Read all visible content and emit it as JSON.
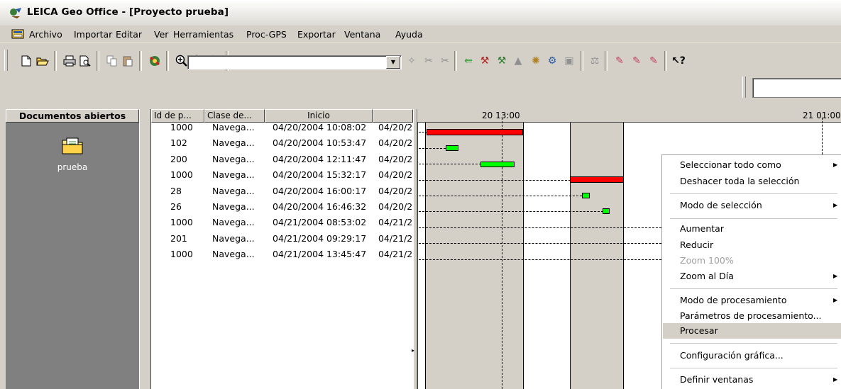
{
  "window": {
    "title": "LEICA Geo Office - [Proyecto prueba]"
  },
  "menu": [
    "Archivo",
    "Importar",
    "Editar",
    "Ver",
    "Herramientas",
    "Proc-GPS",
    "Exportar",
    "Ventana",
    "Ayuda"
  ],
  "toolbar": {
    "icons": [
      "new-document-icon",
      "open-folder-icon",
      "print-icon",
      "print-preview-icon",
      "copy-icon",
      "paste-icon",
      "import-icon",
      "zoom-in-icon",
      "zoom-out-icon",
      "zoom-reset-icon",
      "compass-icon",
      "scissors-icon",
      "scissors-alt-icon",
      "arrow-icon",
      "tool-icon",
      "tool-alt-icon",
      "triangle-icon",
      "satellite-icon",
      "settings-icon",
      "window-icon",
      "balance-icon",
      "brush-icon",
      "brush-alt-icon",
      "brush-alt2-icon",
      "help-icon"
    ],
    "combo_value": ""
  },
  "left_panel": {
    "header": "Documentos abiertos",
    "item_label": "prueba"
  },
  "table": {
    "columns": [
      "Id de p...",
      "Clase de...",
      "Inicio",
      ""
    ],
    "rows": [
      {
        "id": "1000",
        "clase": "Navega...",
        "inicio": "04/20/2004 10:08:02",
        "fin": "04/20/2"
      },
      {
        "id": "102",
        "clase": "Navega...",
        "inicio": "04/20/2004 10:53:47",
        "fin": "04/20/2"
      },
      {
        "id": "200",
        "clase": "Navega...",
        "inicio": "04/20/2004 12:11:47",
        "fin": "04/20/2"
      },
      {
        "id": "1000",
        "clase": "Navega...",
        "inicio": "04/20/2004 15:32:17",
        "fin": "04/20/2"
      },
      {
        "id": "28",
        "clase": "Navega...",
        "inicio": "04/20/2004 16:00:17",
        "fin": "04/20/2"
      },
      {
        "id": "26",
        "clase": "Navega...",
        "inicio": "04/20/2004 16:46:32",
        "fin": "04/20/2"
      },
      {
        "id": "1000",
        "clase": "Navega...",
        "inicio": "04/21/2004 08:53:02",
        "fin": "04/21/2"
      },
      {
        "id": "201",
        "clase": "Navega...",
        "inicio": "04/21/2004 09:29:17",
        "fin": "04/21/2"
      },
      {
        "id": "1000",
        "clase": "Navega...",
        "inicio": "04/21/2004 13:45:47",
        "fin": "04/21/2"
      }
    ]
  },
  "gantt": {
    "header_labels": [
      "20 13:00",
      "21 01:00"
    ],
    "colors": {
      "red": "#ff0000",
      "green": "#00ff00",
      "band": "#d4d0c8"
    }
  },
  "context_menu": {
    "items": [
      {
        "label": "Seleccionar todo como",
        "submenu": true
      },
      {
        "label": "Deshacer toda la selección",
        "submenu": false
      },
      {
        "label": "Modo de selección",
        "submenu": true
      },
      {
        "label": "Aumentar",
        "submenu": false
      },
      {
        "label": "Reducir",
        "submenu": false
      },
      {
        "label": "Zoom 100%",
        "submenu": false,
        "disabled": true
      },
      {
        "label": "Zoom al Día",
        "submenu": true
      },
      {
        "label": "Modo de procesamiento",
        "submenu": true
      },
      {
        "label": "Parámetros de procesamiento...",
        "submenu": false
      },
      {
        "label": "Procesar",
        "submenu": false,
        "highlighted": true
      },
      {
        "label": "Configuración gráfica...",
        "submenu": false
      },
      {
        "label": "Definir ventanas",
        "submenu": true
      }
    ]
  }
}
